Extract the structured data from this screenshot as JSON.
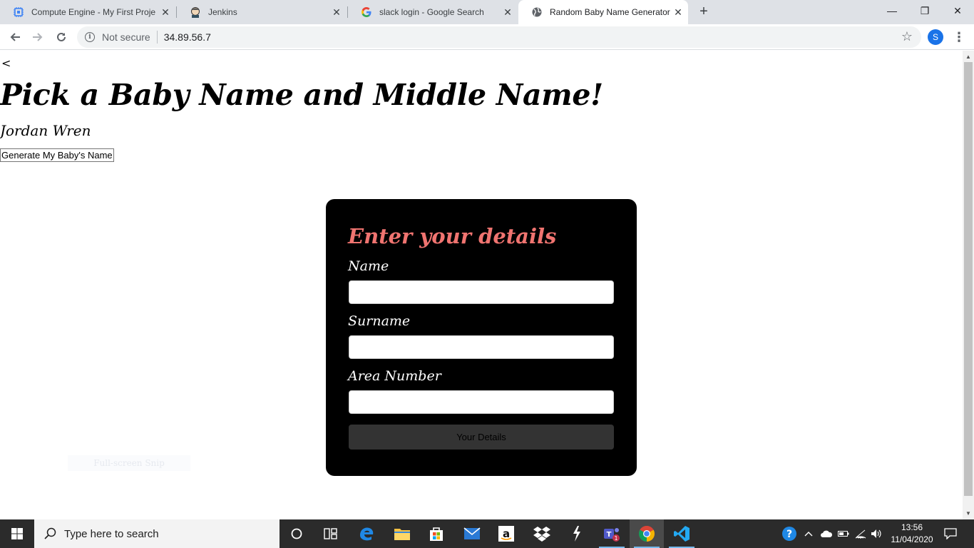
{
  "browser": {
    "tabs": [
      {
        "title": "Compute Engine - My First Proje",
        "icon": "compute-engine-icon",
        "active": false
      },
      {
        "title": "Jenkins",
        "icon": "jenkins-icon",
        "active": false
      },
      {
        "title": "slack login - Google Search",
        "icon": "google-icon",
        "active": false
      },
      {
        "title": "Random Baby Name Generator",
        "icon": "globe-icon",
        "active": true
      }
    ],
    "security_label": "Not secure",
    "url": "34.89.56.7",
    "profile_initial": "S"
  },
  "page": {
    "back_link": "<",
    "title": "Pick a Baby Name and Middle Name!",
    "generated_name": "Jordan Wren",
    "generate_button": "Generate My Baby's Name",
    "form": {
      "title": "Enter your details",
      "fields": [
        {
          "label": "Name",
          "value": ""
        },
        {
          "label": "Surname",
          "value": ""
        },
        {
          "label": "Area Number",
          "value": ""
        }
      ],
      "submit_label": "Your Details"
    },
    "ghost_overlay": "Full-screen Snip"
  },
  "colors": {
    "form_title": "#f07470",
    "card_background": "#000000",
    "submit_background": "#333333"
  },
  "taskbar": {
    "search_placeholder": "Type here to search",
    "pinned": [
      "cortana",
      "task-view",
      "edge",
      "file-explorer",
      "store",
      "mail",
      "amazon",
      "dropbox",
      "teams-ish",
      "teams",
      "chrome",
      "vscode"
    ],
    "time": "13:56",
    "date": "11/04/2020",
    "teams_badge": "1"
  }
}
